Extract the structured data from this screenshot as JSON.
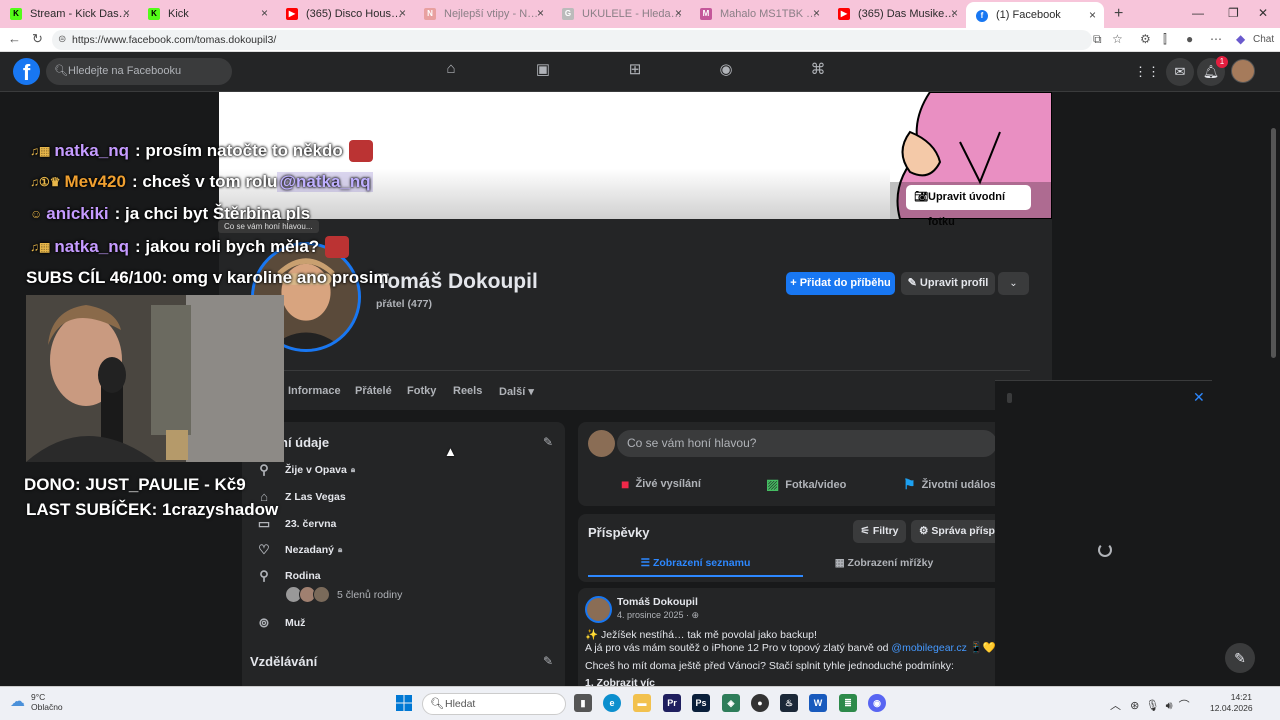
{
  "browser": {
    "tabs": [
      {
        "title": "Stream - Kick Dashboard",
        "icon": "kick-icon",
        "color": "#53fc18"
      },
      {
        "title": "Kick",
        "icon": "kick-icon",
        "color": "#53fc18"
      },
      {
        "title": "(365) Disco House Boog",
        "icon": "youtube-icon",
        "color": "#ff0000"
      },
      {
        "title": "Nejlepší vtipy - NTX.cz - sou",
        "icon": "ntx-icon",
        "color": "#d88"
      },
      {
        "title": "UKULELE - Hledat Googlem",
        "icon": "google-icon",
        "color": "#999"
      },
      {
        "title": "Mahalo MS1TBK Transparen",
        "icon": "shop-icon",
        "color": "#b36"
      },
      {
        "title": "(365) Das Musikers - Papír n",
        "icon": "youtube-icon",
        "color": "#ff0000"
      },
      {
        "title": "(1) Facebook",
        "icon": "facebook-icon",
        "color": "#1877f2"
      }
    ],
    "url": "https://www.facebook.com/tomas.dokoupil3/",
    "chat_label": "Chat"
  },
  "fb": {
    "search_placeholder": "Hledejte na Facebooku",
    "notif_count": "1",
    "edit_cover": "Upravit úvodní fotku",
    "name": "Tomáš Dokoupil",
    "friends": "přátel (477)",
    "add_story": "+ Přidat do příběhu",
    "edit_profile": "Upravit profil",
    "tabs": [
      "Informace",
      "Přátelé",
      "Fotky",
      "Reels",
      "Další"
    ],
    "intro_title": "ní údaje",
    "intro_items": [
      {
        "icon": "location-icon",
        "text": "Žije v Opava",
        "locked": true
      },
      {
        "icon": "home-icon",
        "text": "Z Las Vegas",
        "locked": false
      },
      {
        "icon": "birthday-icon",
        "text": "23. června",
        "locked": false
      },
      {
        "icon": "heart-icon",
        "text": "Nezadaný",
        "locked": true
      },
      {
        "icon": "family-icon",
        "text": "Rodina",
        "locked": false
      },
      {
        "icon": "gender-icon",
        "text": "Muž",
        "locked": false
      }
    ],
    "family_count": "5 členů rodiny",
    "education_title": "Vzdělávání",
    "composer_placeholder": "Co se vám honí hlavou?",
    "composer_actions": [
      "Živé vysílání",
      "Fotka/video",
      "Životní událost"
    ],
    "posts_title": "Příspěvky",
    "filters": "Filtry",
    "manage_posts": "Správa příspě",
    "list_view": "Zobrazení seznamu",
    "grid_view": "Zobrazení mřížky",
    "post": {
      "author": "Tomáš Dokoupil",
      "date": "4. prosince 2025 · ",
      "line1": "✨ Ježíšek nestíhá… tak mě povolal jako backup!",
      "line2_pre": "A já pro vás mám soutěž o iPhone 12 Pro v topový  zlatý barvě od ",
      "line2_link": "@mobilegear.cz",
      "line2_post": " 📱💛",
      "line3": "Chceš ho mít doma ještě před Vánoci? Stačí splnit tyhle jednoduché podmínky:",
      "line4": "1.  Zobrazit víc"
    }
  },
  "overlay": {
    "chat": [
      {
        "user": "natka_nq",
        "user_color": "#c59bff",
        "msg": ": prosím natočte to někdo",
        "mention": ""
      },
      {
        "user": "Mev420",
        "user_color": "#f0a030",
        "msg": ": chceš v tom rolu ",
        "mention": "@natka_nq"
      },
      {
        "user": "anickiki",
        "user_color": "#c59bff",
        "msg": ": ja chci byt Štěrbina pls",
        "mention": ""
      },
      {
        "user": "natka_nq",
        "user_color": "#c59bff",
        "msg": ": jakou roli bych měla?",
        "mention": ""
      }
    ],
    "tooltip": "Co se vám honí hlavou...",
    "subs_goal": "SUBS CÍL 46/100: omg v karoline ano prosim",
    "dono": "DONO: JUST_PAULIE - Kč9",
    "last_sub": "LAST SUBÍČEK: 1crazyshadow"
  },
  "taskbar": {
    "temp": "9°C",
    "weather": "Oblačno",
    "search": "Hledat",
    "time": "14:21",
    "date": "12.04.2026"
  }
}
